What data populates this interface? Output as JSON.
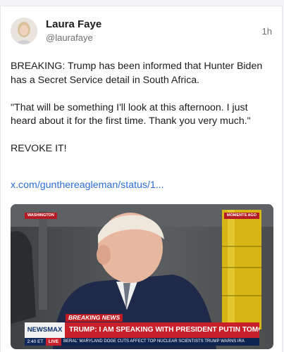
{
  "post": {
    "display_name": "Laura Faye",
    "handle": "@laurafaye",
    "time": "1h",
    "body_paragraphs": [
      "BREAKING: Trump has been informed that Hunter Biden has a Secret Service detail in South Africa.",
      "\"That will be something I'll look at this afternoon. I just heard about it for the first time. Thank you very much.\"",
      "REVOKE IT!"
    ],
    "link_text": "x.com/gunthereagleman/status/1..."
  },
  "media": {
    "bug_left": "WASHINGTON",
    "bug_right": "MOMENTS AGO",
    "label": "BREAKING NEWS",
    "network": "NEWSMAX",
    "headline": "TRUMP: I AM SPEAKING WITH PRESIDENT PUTIN TOMORROW",
    "ticker_time": "2:40 ET",
    "ticker_live": "LIVE",
    "ticker_text": "BERAL' MARYLAND    DOGE CUTS AFFECT TOP NUCLEAR SCIENTISTS    TRUMP WARNS IRA"
  },
  "colors": {
    "link": "#2b6fd6",
    "breaking_red": "#c8202a",
    "network_blue": "#0d2550"
  }
}
